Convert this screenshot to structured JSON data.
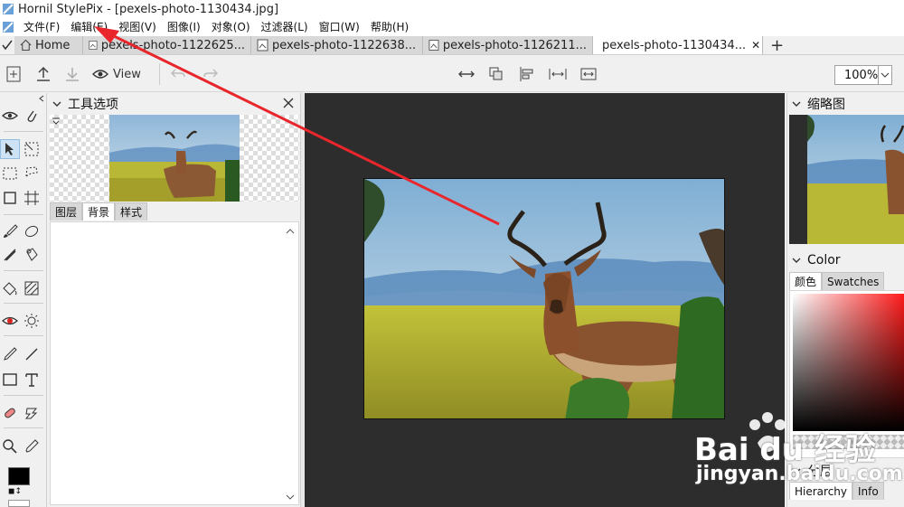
{
  "window": {
    "title": "Hornil StylePix - [pexels-photo-1130434.jpg]"
  },
  "menu": {
    "items": [
      "文件(F)",
      "编辑(E)",
      "视图(V)",
      "图像(I)",
      "对象(O)",
      "过滤器(L)",
      "窗口(W)",
      "帮助(H)"
    ]
  },
  "tabs": [
    {
      "label": "Home"
    },
    {
      "label": "pexels-photo-1122625..."
    },
    {
      "label": "pexels-photo-1122638..."
    },
    {
      "label": "pexels-photo-1126211..."
    },
    {
      "label": "pexels-photo-1130434..."
    }
  ],
  "toolbar": {
    "view_label": "View",
    "zoom": "100%"
  },
  "tool_options": {
    "title": "工具选项",
    "subtabs": [
      "图层",
      "背景",
      "样式"
    ],
    "active_subtab": "背景"
  },
  "right_panel": {
    "thumbnail_title": "缩略图",
    "color_title": "Color",
    "color_tabs": [
      "颜色",
      "Swatches"
    ],
    "layers_title": "分层",
    "layers_tabs": [
      "Hierarchy",
      "Info"
    ],
    "selected_color": "#ff1a1a"
  },
  "watermark": {
    "brand": "Bai  du 经验",
    "url": "jingyan.baidu.com"
  },
  "colors": {
    "arrow": "#e8262b",
    "canvas_bg": "#2d2d2d",
    "foreground": "#000000"
  }
}
